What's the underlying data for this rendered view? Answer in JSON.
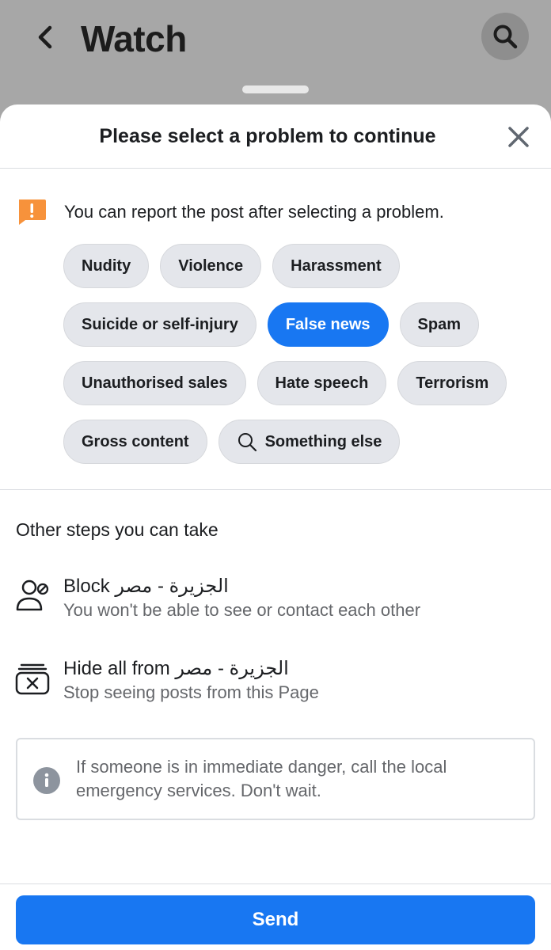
{
  "header": {
    "title": "Watch",
    "back_icon": "chevron-left-icon",
    "search_icon": "search-icon"
  },
  "sheet": {
    "title": "Please select a problem to continue",
    "close_icon": "close-icon",
    "notice": {
      "icon": "warning-icon",
      "text": "You can report the post after selecting a problem.",
      "icon_color": "#f7923b"
    },
    "chip_rows": [
      [
        {
          "label": "Nudity",
          "selected": false
        },
        {
          "label": "Violence",
          "selected": false
        },
        {
          "label": "Harassment",
          "selected": false
        }
      ],
      [
        {
          "label": "Suicide or self-injury",
          "selected": false
        },
        {
          "label": "False news",
          "selected": true
        },
        {
          "label": "Spam",
          "selected": false
        }
      ],
      [
        {
          "label": "Unauthorised sales",
          "selected": false
        },
        {
          "label": "Hate speech",
          "selected": false
        },
        {
          "label": "Terrorism",
          "selected": false
        }
      ],
      [
        {
          "label": "Gross content",
          "selected": false
        },
        {
          "label": "Something else",
          "selected": false,
          "icon": "search-icon"
        }
      ]
    ],
    "other_steps": {
      "title": "Other steps you can take",
      "options": [
        {
          "icon": "block-user-icon",
          "title": "Block الجزيرة - مصر",
          "subtitle": "You won't be able to see or contact each other"
        },
        {
          "icon": "hide-all-icon",
          "title": "Hide all from الجزيرة - مصر",
          "subtitle": "Stop seeing posts from this Page"
        }
      ]
    },
    "info": {
      "icon": "info-icon",
      "text": "If someone is in immediate danger, call the local emergency services. Don't wait."
    },
    "send_label": "Send"
  },
  "colors": {
    "accent": "#1877f2",
    "chip_bg": "#e4e6eb",
    "overlay": "#a7a7a7"
  }
}
